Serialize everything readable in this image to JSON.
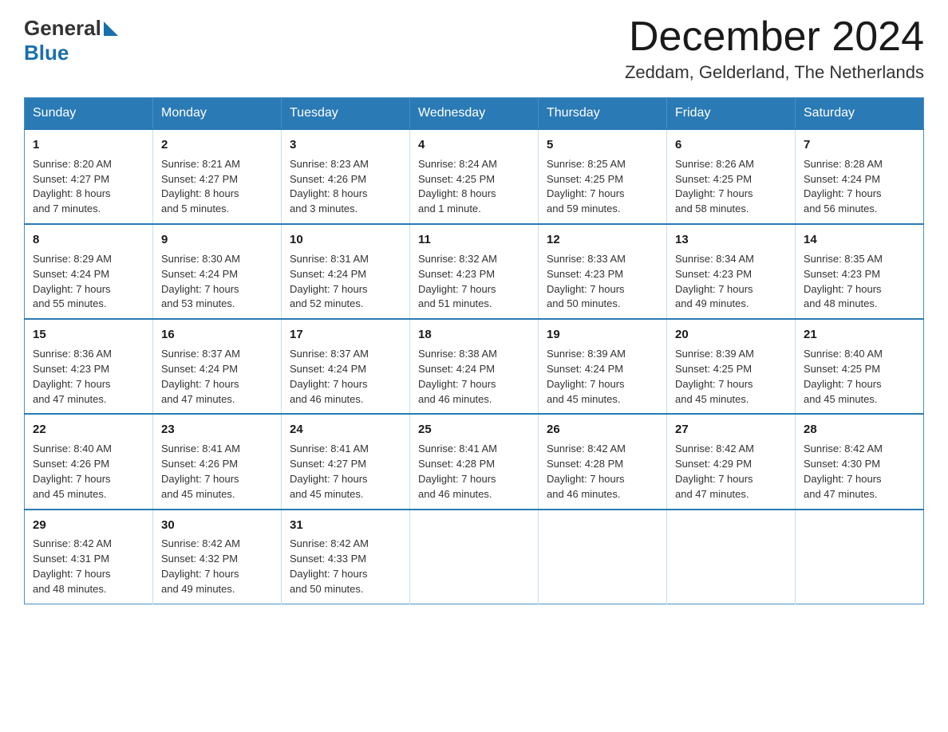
{
  "header": {
    "logo_general": "General",
    "logo_blue": "Blue",
    "month_title": "December 2024",
    "location": "Zeddam, Gelderland, The Netherlands"
  },
  "days_of_week": [
    "Sunday",
    "Monday",
    "Tuesday",
    "Wednesday",
    "Thursday",
    "Friday",
    "Saturday"
  ],
  "weeks": [
    [
      {
        "day": "1",
        "sunrise": "8:20 AM",
        "sunset": "4:27 PM",
        "daylight": "8 hours and 7 minutes."
      },
      {
        "day": "2",
        "sunrise": "8:21 AM",
        "sunset": "4:27 PM",
        "daylight": "8 hours and 5 minutes."
      },
      {
        "day": "3",
        "sunrise": "8:23 AM",
        "sunset": "4:26 PM",
        "daylight": "8 hours and 3 minutes."
      },
      {
        "day": "4",
        "sunrise": "8:24 AM",
        "sunset": "4:25 PM",
        "daylight": "8 hours and 1 minute."
      },
      {
        "day": "5",
        "sunrise": "8:25 AM",
        "sunset": "4:25 PM",
        "daylight": "7 hours and 59 minutes."
      },
      {
        "day": "6",
        "sunrise": "8:26 AM",
        "sunset": "4:25 PM",
        "daylight": "7 hours and 58 minutes."
      },
      {
        "day": "7",
        "sunrise": "8:28 AM",
        "sunset": "4:24 PM",
        "daylight": "7 hours and 56 minutes."
      }
    ],
    [
      {
        "day": "8",
        "sunrise": "8:29 AM",
        "sunset": "4:24 PM",
        "daylight": "7 hours and 55 minutes."
      },
      {
        "day": "9",
        "sunrise": "8:30 AM",
        "sunset": "4:24 PM",
        "daylight": "7 hours and 53 minutes."
      },
      {
        "day": "10",
        "sunrise": "8:31 AM",
        "sunset": "4:24 PM",
        "daylight": "7 hours and 52 minutes."
      },
      {
        "day": "11",
        "sunrise": "8:32 AM",
        "sunset": "4:23 PM",
        "daylight": "7 hours and 51 minutes."
      },
      {
        "day": "12",
        "sunrise": "8:33 AM",
        "sunset": "4:23 PM",
        "daylight": "7 hours and 50 minutes."
      },
      {
        "day": "13",
        "sunrise": "8:34 AM",
        "sunset": "4:23 PM",
        "daylight": "7 hours and 49 minutes."
      },
      {
        "day": "14",
        "sunrise": "8:35 AM",
        "sunset": "4:23 PM",
        "daylight": "7 hours and 48 minutes."
      }
    ],
    [
      {
        "day": "15",
        "sunrise": "8:36 AM",
        "sunset": "4:23 PM",
        "daylight": "7 hours and 47 minutes."
      },
      {
        "day": "16",
        "sunrise": "8:37 AM",
        "sunset": "4:24 PM",
        "daylight": "7 hours and 47 minutes."
      },
      {
        "day": "17",
        "sunrise": "8:37 AM",
        "sunset": "4:24 PM",
        "daylight": "7 hours and 46 minutes."
      },
      {
        "day": "18",
        "sunrise": "8:38 AM",
        "sunset": "4:24 PM",
        "daylight": "7 hours and 46 minutes."
      },
      {
        "day": "19",
        "sunrise": "8:39 AM",
        "sunset": "4:24 PM",
        "daylight": "7 hours and 45 minutes."
      },
      {
        "day": "20",
        "sunrise": "8:39 AM",
        "sunset": "4:25 PM",
        "daylight": "7 hours and 45 minutes."
      },
      {
        "day": "21",
        "sunrise": "8:40 AM",
        "sunset": "4:25 PM",
        "daylight": "7 hours and 45 minutes."
      }
    ],
    [
      {
        "day": "22",
        "sunrise": "8:40 AM",
        "sunset": "4:26 PM",
        "daylight": "7 hours and 45 minutes."
      },
      {
        "day": "23",
        "sunrise": "8:41 AM",
        "sunset": "4:26 PM",
        "daylight": "7 hours and 45 minutes."
      },
      {
        "day": "24",
        "sunrise": "8:41 AM",
        "sunset": "4:27 PM",
        "daylight": "7 hours and 45 minutes."
      },
      {
        "day": "25",
        "sunrise": "8:41 AM",
        "sunset": "4:28 PM",
        "daylight": "7 hours and 46 minutes."
      },
      {
        "day": "26",
        "sunrise": "8:42 AM",
        "sunset": "4:28 PM",
        "daylight": "7 hours and 46 minutes."
      },
      {
        "day": "27",
        "sunrise": "8:42 AM",
        "sunset": "4:29 PM",
        "daylight": "7 hours and 47 minutes."
      },
      {
        "day": "28",
        "sunrise": "8:42 AM",
        "sunset": "4:30 PM",
        "daylight": "7 hours and 47 minutes."
      }
    ],
    [
      {
        "day": "29",
        "sunrise": "8:42 AM",
        "sunset": "4:31 PM",
        "daylight": "7 hours and 48 minutes."
      },
      {
        "day": "30",
        "sunrise": "8:42 AM",
        "sunset": "4:32 PM",
        "daylight": "7 hours and 49 minutes."
      },
      {
        "day": "31",
        "sunrise": "8:42 AM",
        "sunset": "4:33 PM",
        "daylight": "7 hours and 50 minutes."
      },
      null,
      null,
      null,
      null
    ]
  ],
  "labels": {
    "sunrise": "Sunrise:",
    "sunset": "Sunset:",
    "daylight": "Daylight:"
  }
}
